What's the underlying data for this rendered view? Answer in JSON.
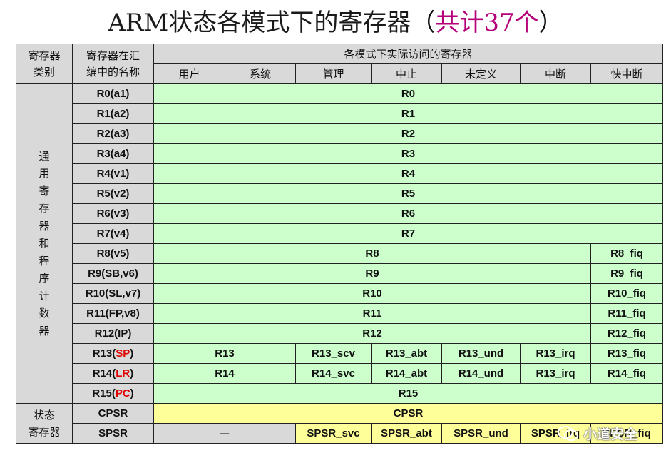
{
  "title": {
    "main": "ARM状态各模式下的寄存器",
    "paren_open": "（",
    "count": "共计37个",
    "paren_close": "）"
  },
  "header": {
    "category": "寄存器\n类别",
    "asm_name": "寄存器在汇\n编中的名称",
    "modes_title": "各模式下实际访问的寄存器",
    "modes": [
      "用户",
      "系统",
      "管理",
      "中止",
      "未定义",
      "中断",
      "快中断"
    ]
  },
  "categories": {
    "general": "通\n用\n寄\n存\n器\n和\n程\n序\n计\n数\n器",
    "status": "状态\n寄存器"
  },
  "rows": {
    "r0": {
      "name": "R0(a1)",
      "shared": "R0"
    },
    "r1": {
      "name": "R1(a2)",
      "shared": "R1"
    },
    "r2": {
      "name": "R2(a3)",
      "shared": "R2"
    },
    "r3": {
      "name": "R3(a4)",
      "shared": "R3"
    },
    "r4": {
      "name": "R4(v1)",
      "shared": "R4"
    },
    "r5": {
      "name": "R5(v2)",
      "shared": "R5"
    },
    "r6": {
      "name": "R6(v3)",
      "shared": "R6"
    },
    "r7": {
      "name": "R7(v4)",
      "shared": "R7"
    },
    "r8": {
      "name": "R8(v5)",
      "shared": "R8",
      "fiq": "R8_fiq"
    },
    "r9": {
      "name": "R9(SB,v6)",
      "shared": "R9",
      "fiq": "R9_fiq"
    },
    "r10": {
      "name": "R10(SL,v7)",
      "shared": "R10",
      "fiq": "R10_fiq"
    },
    "r11": {
      "name": "R11(FP,v8)",
      "shared": "R11",
      "fiq": "R11_fiq"
    },
    "r12": {
      "name": "R12(IP)",
      "shared": "R12",
      "fiq": "R12_fiq"
    },
    "r13": {
      "name_pre": "R13(",
      "name_red": "SP",
      "name_post": ")",
      "usr_sys": "R13",
      "svc": "R13_scv",
      "abt": "R13_abt",
      "und": "R13_und",
      "irq": "R13_irq",
      "fiq": "R13_fiq"
    },
    "r14": {
      "name_pre": "R14(",
      "name_red": "LR",
      "name_post": ")",
      "usr_sys": "R14",
      "svc": "R14_svc",
      "abt": "R14_abt",
      "und": "R14_und",
      "irq": "R13_irq",
      "fiq": "R14_fiq"
    },
    "r15": {
      "name_pre": "R15(",
      "name_red": "PC",
      "name_post": ")",
      "shared": "R15"
    },
    "cpsr": {
      "name": "CPSR",
      "shared": "CPSR"
    },
    "spsr": {
      "name": "SPSR",
      "usr_sys": "—",
      "svc": "SPSR_svc",
      "abt": "SPSR_abt",
      "und": "SPSR_und",
      "irq": "SPSR_irq",
      "fiq": "SPSR_fiq"
    }
  },
  "watermark": {
    "text": "小道安全",
    "icon": "wechat-icon"
  },
  "colors": {
    "green": "#ccffcc",
    "yellow": "#ffff99",
    "grey": "#d9d9d9",
    "accent": "#b5007a",
    "red": "#e00000"
  }
}
